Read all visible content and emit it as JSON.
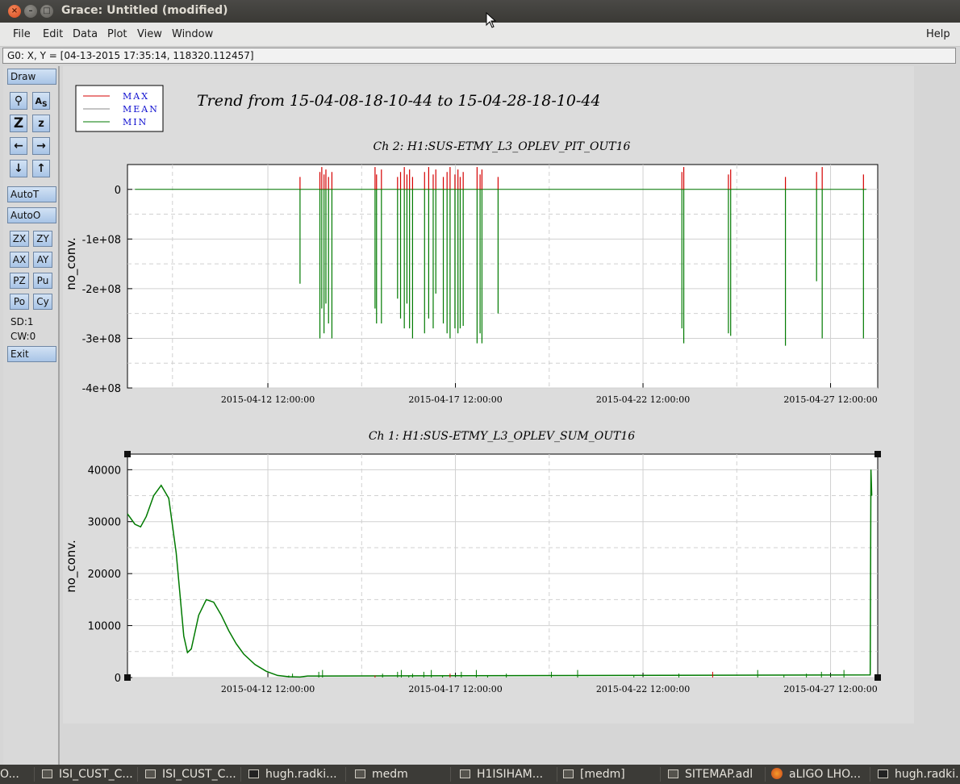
{
  "window": {
    "title": "Grace: Untitled (modified)"
  },
  "menu": {
    "file": "File",
    "edit": "Edit",
    "data": "Data",
    "plot": "Plot",
    "view": "View",
    "window": "Window",
    "help": "Help"
  },
  "locator": "G0: X, Y = [04-13-2015 17:35:14, 118320.112457]",
  "toolbar": {
    "draw": "Draw",
    "autot": "AutoT",
    "autoo": "AutoO",
    "zx": "ZX",
    "zy": "ZY",
    "ax": "AX",
    "ay": "AY",
    "pz": "PZ",
    "pu": "Pu",
    "po": "Po",
    "cy": "Cy",
    "sd": "SD:1",
    "cw": "CW:0",
    "exit": "Exit",
    "icons": [
      "zoom-icon",
      "text-icon",
      "zoom-in-icon",
      "zoom-out-icon",
      "left-arrow-icon",
      "right-arrow-icon",
      "down-arrow-icon",
      "up-arrow-icon"
    ]
  },
  "figure": {
    "title": "Trend from 15-04-08-18-10-44 to 15-04-28-18-10-44",
    "legend": [
      "MAX",
      "MEAN",
      "MIN"
    ],
    "legend_colors": [
      "#d40000",
      "#888888",
      "#007a00"
    ]
  },
  "chart_data": [
    {
      "type": "line",
      "title": "Ch 2: H1:SUS-ETMY_L3_OPLEV_PIT_OUT16",
      "ylabel": "no_conv.",
      "xlabel": "",
      "xlim": [
        "2015-04-08 18:10:44",
        "2015-04-28 18:10:44"
      ],
      "ylim": [
        -400000000,
        0
      ],
      "x_ticks": [
        "2015-04-12 12:00:00",
        "2015-04-17 12:00:00",
        "2015-04-22 12:00:00",
        "2015-04-27 12:00:00"
      ],
      "y_ticks": [
        "0",
        "-1e+08",
        "-2e+08",
        "-3e+08",
        "-4e+08"
      ],
      "grid": true,
      "series": [
        {
          "name": "MAX",
          "color": "#d40000",
          "baseline": 0
        },
        {
          "name": "MEAN",
          "color": "#888888",
          "baseline": 0
        },
        {
          "name": "MIN",
          "color": "#007a00",
          "baseline": 0
        }
      ],
      "spikes_days": [
        [
          4.6,
          -190000000
        ],
        [
          5.13,
          -300000000
        ],
        [
          5.18,
          -240000000
        ],
        [
          5.24,
          -290000000
        ],
        [
          5.29,
          -230000000
        ],
        [
          5.36,
          -270000000
        ],
        [
          5.45,
          -300000000
        ],
        [
          6.6,
          -240000000
        ],
        [
          6.64,
          -270000000
        ],
        [
          6.77,
          -270000000
        ],
        [
          7.2,
          -220000000
        ],
        [
          7.28,
          -260000000
        ],
        [
          7.38,
          -280000000
        ],
        [
          7.45,
          -230000000
        ],
        [
          7.52,
          -280000000
        ],
        [
          7.6,
          -300000000
        ],
        [
          7.92,
          -290000000
        ],
        [
          8.03,
          -260000000
        ],
        [
          8.15,
          -280000000
        ],
        [
          8.22,
          -210000000
        ],
        [
          8.42,
          -270000000
        ],
        [
          8.52,
          -290000000
        ],
        [
          8.6,
          -300000000
        ],
        [
          8.73,
          -280000000
        ],
        [
          8.81,
          -290000000
        ],
        [
          8.87,
          -280000000
        ],
        [
          8.95,
          -275000000
        ],
        [
          9.32,
          -310000000
        ],
        [
          9.4,
          -290000000
        ],
        [
          9.45,
          -310000000
        ],
        [
          9.88,
          -250000000
        ],
        [
          14.78,
          -280000000
        ],
        [
          14.83,
          -310000000
        ],
        [
          16.02,
          -290000000
        ],
        [
          16.08,
          -295000000
        ],
        [
          17.54,
          -315000000
        ],
        [
          18.37,
          -185000000
        ],
        [
          18.52,
          -300000000
        ],
        [
          19.62,
          -300000000
        ]
      ]
    },
    {
      "type": "line",
      "title": "Ch 1: H1:SUS-ETMY_L3_OPLEV_SUM_OUT16",
      "ylabel": "no_conv.",
      "xlabel": "",
      "xlim": [
        "2015-04-08 18:10:44",
        "2015-04-28 18:10:44"
      ],
      "ylim": [
        0,
        43000
      ],
      "x_ticks": [
        "2015-04-12 12:00:00",
        "2015-04-17 12:00:00",
        "2015-04-22 12:00:00",
        "2015-04-27 12:00:00"
      ],
      "y_ticks": [
        "0",
        "10000",
        "20000",
        "30000",
        "40000"
      ],
      "grid": true,
      "series": [
        {
          "name": "MIN",
          "color": "#007a00",
          "x_days": [
            0.0,
            0.2,
            0.35,
            0.5,
            0.7,
            0.9,
            1.1,
            1.3,
            1.5,
            1.6,
            1.7,
            1.9,
            2.1,
            2.3,
            2.5,
            2.7,
            2.9,
            3.1,
            3.4,
            3.7,
            4.0,
            4.3,
            4.6,
            4.8,
            5.2,
            19.8,
            19.82,
            19.84
          ],
          "values": [
            31500,
            29500,
            29000,
            31000,
            35000,
            37000,
            34500,
            24000,
            8000,
            4800,
            5500,
            12000,
            15000,
            14500,
            12000,
            9000,
            6500,
            4500,
            2500,
            1200,
            400,
            150,
            100,
            300,
            300,
            500,
            40000,
            35000
          ]
        }
      ]
    }
  ]
}
